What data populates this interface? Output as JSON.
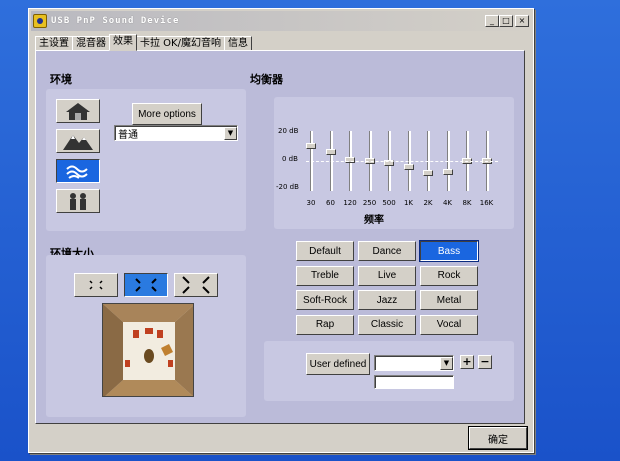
{
  "window": {
    "title": "USB PnP Sound Device",
    "btn_min": "_",
    "btn_max": "□",
    "btn_close": "×"
  },
  "tabs": [
    {
      "label": "主设置"
    },
    {
      "label": "混音器"
    },
    {
      "label": "效果"
    },
    {
      "label": "卡拉 OK/魔幻音响"
    },
    {
      "label": "信息"
    }
  ],
  "environment": {
    "heading": "环境",
    "more_options": "More options",
    "preset_value": "普通",
    "buttons": [
      {
        "icon": "house-icon",
        "active": false
      },
      {
        "icon": "mountain-icon",
        "active": false
      },
      {
        "icon": "water-icon",
        "active": true
      },
      {
        "icon": "people-icon",
        "active": false
      }
    ]
  },
  "env_size": {
    "heading": "环境大小",
    "sizes": [
      {
        "label": "small",
        "glyph": "✕",
        "active": false
      },
      {
        "label": "medium",
        "glyph": "✕",
        "active": true
      },
      {
        "label": "large",
        "glyph": "✕",
        "active": false
      }
    ]
  },
  "equalizer": {
    "heading": "均衡器",
    "axis_label": "频率",
    "db_labels": [
      "20 dB",
      "0 dB",
      "-20 dB"
    ],
    "bands": [
      {
        "freq": "30",
        "db": 10
      },
      {
        "freq": "60",
        "db": 6
      },
      {
        "freq": "120",
        "db": 1
      },
      {
        "freq": "250",
        "db": 0
      },
      {
        "freq": "500",
        "db": -1
      },
      {
        "freq": "1K",
        "db": -4
      },
      {
        "freq": "2K",
        "db": -8
      },
      {
        "freq": "4K",
        "db": -7
      },
      {
        "freq": "8K",
        "db": 0
      },
      {
        "freq": "16K",
        "db": 0
      }
    ]
  },
  "presets": [
    {
      "label": "Default",
      "active": false
    },
    {
      "label": "Dance",
      "active": false
    },
    {
      "label": "Bass",
      "active": true
    },
    {
      "label": "Treble",
      "active": false
    },
    {
      "label": "Live",
      "active": false
    },
    {
      "label": "Rock",
      "active": false
    },
    {
      "label": "Soft-Rock",
      "active": false
    },
    {
      "label": "Jazz",
      "active": false
    },
    {
      "label": "Metal",
      "active": false
    },
    {
      "label": "Rap",
      "active": false
    },
    {
      "label": "Classic",
      "active": false
    },
    {
      "label": "Vocal",
      "active": false
    }
  ],
  "user_defined": {
    "button": "User defined",
    "select_value": "",
    "name_value": "",
    "add": "+",
    "remove": "−"
  },
  "ok_button": "确定"
}
